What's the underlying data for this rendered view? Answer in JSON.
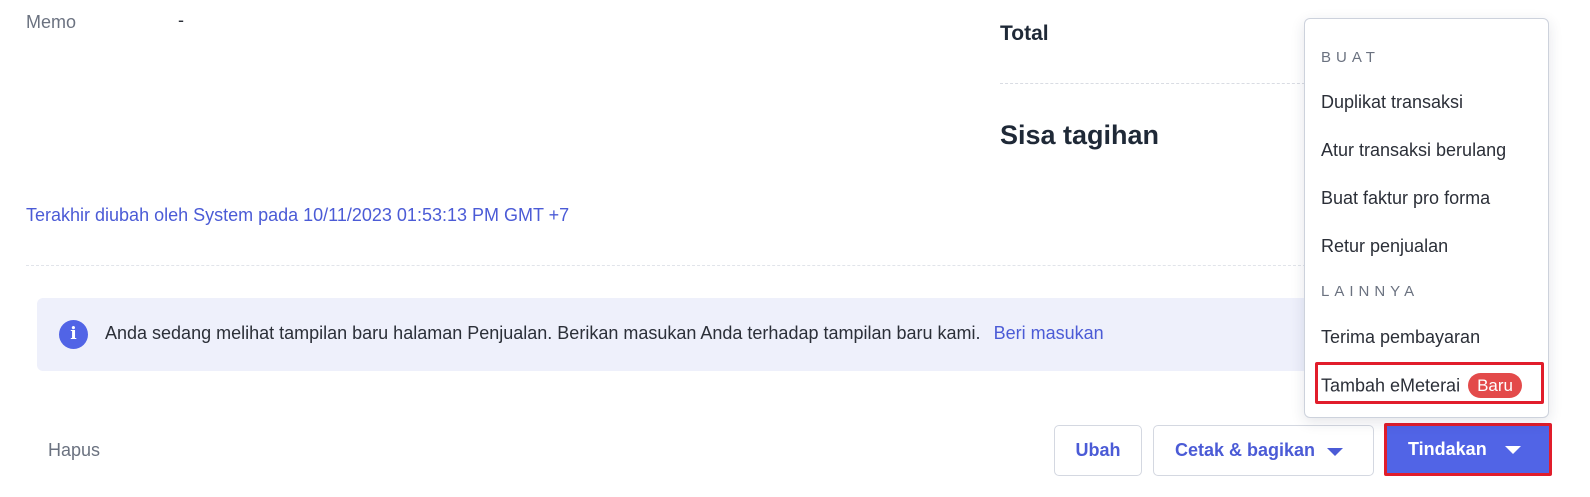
{
  "details": {
    "memo_label": "Memo",
    "memo_value": "-"
  },
  "summary": {
    "total_label": "Total",
    "balance_label": "Sisa tagihan"
  },
  "audit": {
    "last_modified_text": "Terakhir diubah oleh System pada 10/11/2023 01:53:13 PM GMT +7"
  },
  "info_banner": {
    "icon": "info-icon",
    "icon_glyph": "i",
    "message": "Anda sedang melihat tampilan baru halaman Penjualan. Berikan masukan Anda terhadap tampilan baru kami.",
    "link_label": "Beri masukan"
  },
  "footer": {
    "delete_label": "Hapus",
    "edit_label": "Ubah",
    "print_share_label": "Cetak & bagikan",
    "actions_label": "Tindakan"
  },
  "actions_menu": {
    "create_section": "BUAT",
    "create_items": [
      "Duplikat transaksi",
      "Atur transaksi berulang",
      "Buat faktur pro forma",
      "Retur penjualan"
    ],
    "other_section": "LAINNYA",
    "other_items": [
      "Terima pembayaran"
    ],
    "emeterai_label": "Tambah eMeterai",
    "new_badge": "Baru"
  },
  "colors": {
    "accent": "#5164e6",
    "link": "#4b5bd6",
    "highlight_outline": "#e11d2b",
    "badge": "#e34a4a",
    "banner_bg": "#eef0fb"
  }
}
